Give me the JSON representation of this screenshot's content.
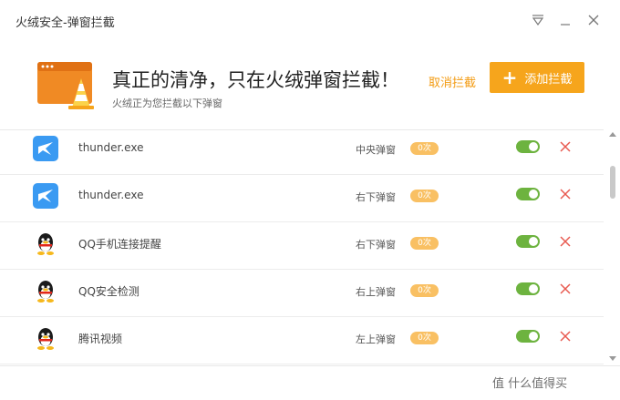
{
  "window": {
    "title": "火绒安全-弹窗拦截"
  },
  "header": {
    "headline": "真正的清净，只在火绒弹窗拦截！",
    "subline": "火绒正为您拦截以下弹窗",
    "cancel_label": "取消拦截",
    "add_label": "添加拦截",
    "add_icon": "plus-icon"
  },
  "rows": [
    {
      "name": "thunder.exe",
      "type": "中央弹窗",
      "count": "0次",
      "icon": "thunder-icon",
      "enabled": true
    },
    {
      "name": "thunder.exe",
      "type": "右下弹窗",
      "count": "0次",
      "icon": "thunder-icon",
      "enabled": true
    },
    {
      "name": "QQ手机连接提醒",
      "type": "右下弹窗",
      "count": "0次",
      "icon": "qq-penguin-icon",
      "enabled": true
    },
    {
      "name": "QQ安全检测",
      "type": "右上弹窗",
      "count": "0次",
      "icon": "qq-penguin-icon",
      "enabled": true
    },
    {
      "name": "腾讯视频",
      "type": "左上弹窗",
      "count": "0次",
      "icon": "qq-penguin-icon",
      "enabled": true
    }
  ],
  "footer": {
    "watermark": "值 什么值得买"
  },
  "colors": {
    "accent": "#f6a51c",
    "toggle_on": "#6db33f",
    "delete": "#e85a50",
    "badge": "#f9c063"
  }
}
